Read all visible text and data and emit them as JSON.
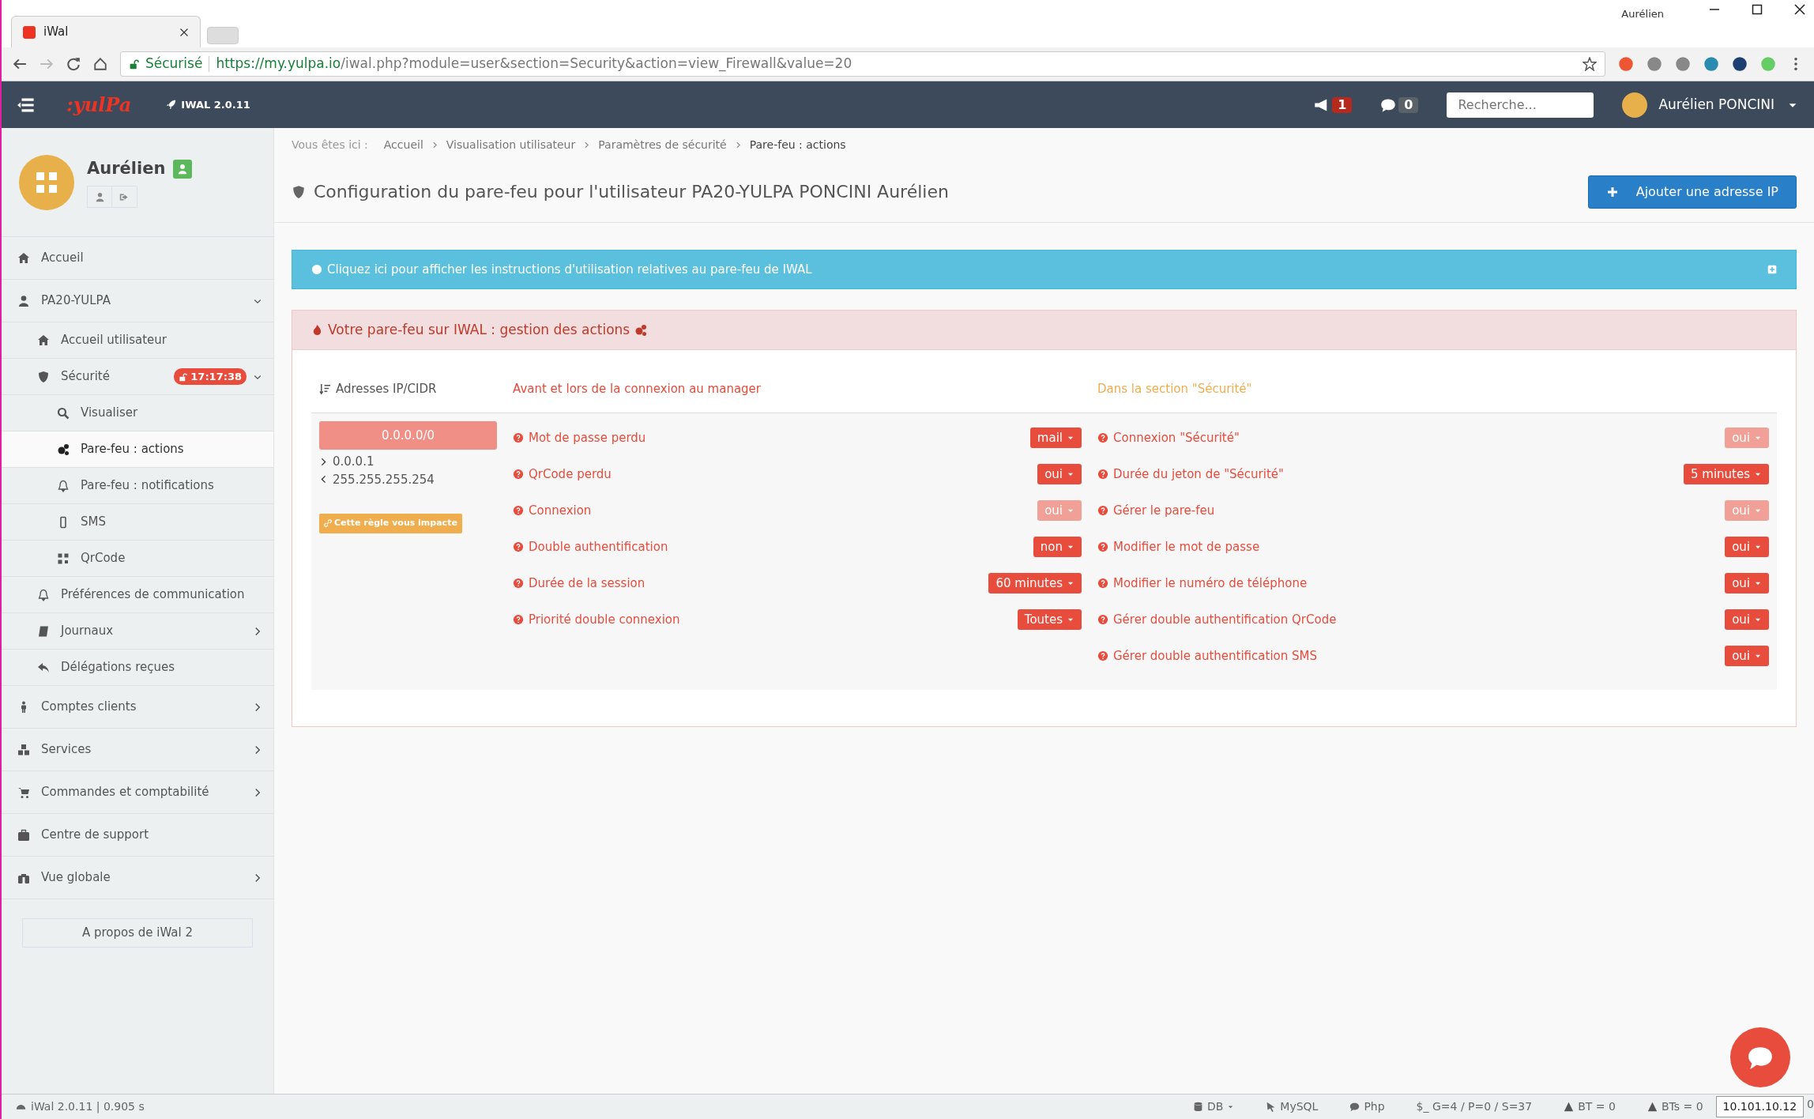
{
  "browser": {
    "tab_title": "iWal",
    "profile": "Aurélien",
    "security": "Sécurisé",
    "url_host": "https://my.yulpa.io",
    "url_path": "/iwal.php?module=user&section=Security&action=view_Firewall&value=20"
  },
  "navbar": {
    "logo": ":yulPa",
    "version": "IWAL 2.0.11",
    "notifications": "1",
    "messages": "0",
    "search_placeholder": "Recherche...",
    "user": "Aurélien PONCINI"
  },
  "profile": {
    "name": "Aurélien"
  },
  "sidebar": {
    "items": [
      {
        "label": "Accueil",
        "selected": false
      },
      {
        "label": "PA20-YULPA",
        "selected": false,
        "expanded": true,
        "children": [
          {
            "label": "Accueil utilisateur",
            "selected": false
          },
          {
            "label": "Sécurité",
            "selected": false,
            "expanded": true,
            "badge": "17:17:38",
            "children": [
              {
                "label": "Visualiser",
                "selected": false
              },
              {
                "label": "Pare-feu : actions",
                "selected": true
              },
              {
                "label": "Pare-feu : notifications",
                "selected": false
              },
              {
                "label": "SMS",
                "selected": false
              },
              {
                "label": "QrCode",
                "selected": false
              }
            ]
          },
          {
            "label": "Préférences de communication",
            "selected": false
          },
          {
            "label": "Journaux",
            "selected": false,
            "expanded": false
          },
          {
            "label": "Délégations reçues",
            "selected": false
          }
        ]
      },
      {
        "label": "Comptes clients",
        "selected": false,
        "expanded": false
      },
      {
        "label": "Services",
        "selected": false,
        "expanded": false
      },
      {
        "label": "Commandes et comptabilité",
        "selected": false,
        "expanded": false
      },
      {
        "label": "Centre de support",
        "selected": false
      },
      {
        "label": "Vue globale",
        "selected": false,
        "expanded": false
      }
    ],
    "about": "A propos de iWal 2"
  },
  "breadcrumb": {
    "label": "Vous êtes ici :",
    "items": [
      "Accueil",
      "Visualisation utilisateur",
      "Paramètres de sécurité",
      "Pare-feu : actions"
    ]
  },
  "page_title": "Configuration du pare-feu pour l'utilisateur PA20-YULPA PONCINI Aurélien",
  "add_button": "Ajouter une adresse IP",
  "info_banner": "Cliquez ici pour afficher les instructions d'utilisation relatives au pare-feu de IWAL",
  "firewall": {
    "title": "Votre pare-feu sur IWAL : gestion des actions",
    "columns": [
      "Adresses IP/CIDR",
      "Avant et lors de la connexion au manager",
      "Dans la section \"Sécurité\""
    ],
    "rule": {
      "cidr": "0.0.0.0/0",
      "start": "0.0.0.1",
      "end": "255.255.255.254",
      "impact": "Cette règle vous impacte"
    },
    "before_rows": [
      {
        "label": "Mot de passe perdu",
        "value": "mail",
        "disabled": false
      },
      {
        "label": "QrCode perdu",
        "value": "oui",
        "disabled": false
      },
      {
        "label": "Connexion",
        "value": "oui",
        "disabled": true
      },
      {
        "label": "Double authentification",
        "value": "non",
        "disabled": false
      },
      {
        "label": "Durée de la session",
        "value": "60 minutes",
        "disabled": false
      },
      {
        "label": "Priorité double connexion",
        "value": "Toutes",
        "disabled": false
      }
    ],
    "section_rows": [
      {
        "label": "Connexion \"Sécurité\"",
        "value": "oui",
        "disabled": true
      },
      {
        "label": "Durée du jeton de \"Sécurité\"",
        "value": "5 minutes",
        "disabled": false
      },
      {
        "label": "Gérer le pare-feu",
        "value": "oui",
        "disabled": true
      },
      {
        "label": "Modifier le mot de passe",
        "value": "oui",
        "disabled": false
      },
      {
        "label": "Modifier le numéro de téléphone",
        "value": "oui",
        "disabled": false
      },
      {
        "label": "Gérer double authentification QrCode",
        "value": "oui",
        "disabled": false
      },
      {
        "label": "Gérer double authentification SMS",
        "value": "oui",
        "disabled": false
      }
    ]
  },
  "status_bar": {
    "app": "iWal 2.0.11 | 0.905 s",
    "db": "DB",
    "mysql": "MySQL",
    "php": "Php",
    "vars": "$_ G=4 / P=0 / S=37",
    "bt": "BT = 0",
    "bts": "BTs = 0",
    "ip": "10.101.10.12",
    "extra": "0"
  }
}
